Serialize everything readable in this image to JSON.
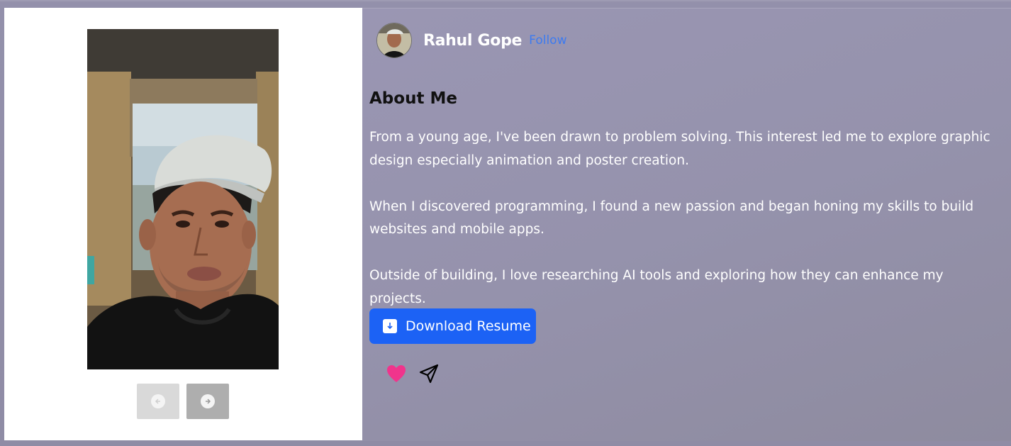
{
  "profile": {
    "name": "Rahul Gope",
    "follow_label": "Follow"
  },
  "about": {
    "heading": "About Me",
    "paragraphs": [
      "From a young age, I've been drawn to problem solving. This interest led me to explore graphic design especially animation and poster creation.",
      "When I discovered programming, I found a new passion and began honing my skills to build websites and mobile apps.",
      "Outside of building, I love researching AI tools and exploring how they can enhance my projects."
    ]
  },
  "actions": {
    "download_label": "Download Resume",
    "icons": [
      "download-icon",
      "heart-icon",
      "send-icon",
      "arrow-left-icon",
      "arrow-right-icon"
    ]
  },
  "colors": {
    "accent": "#1c62f5",
    "follow": "#3d7bf0",
    "heart": "#f0348c",
    "panel": "#9592ac"
  }
}
